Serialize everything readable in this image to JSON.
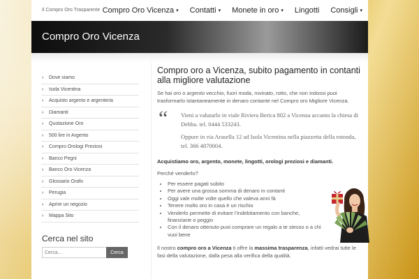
{
  "site": {
    "tagline": "Il Compro Oro Trasparente",
    "header_title": "Compro Oro Vicenza"
  },
  "nav": {
    "items": [
      {
        "label": "Compro Oro Vicenza",
        "caret": "▾"
      },
      {
        "label": "Contatti",
        "caret": "▾"
      },
      {
        "label": "Monete in oro",
        "caret": "▾"
      },
      {
        "label": "Lingotti",
        "caret": ""
      },
      {
        "label": "Consigli",
        "caret": "▾"
      }
    ]
  },
  "sidebar": {
    "items": [
      "Dove siamo",
      "Isola Vicentina",
      "Acquisto argento e argenteria",
      "Diamanti",
      "Quotazione Oro",
      "500 lire in Argento",
      "Compro Orologi Preziosi",
      "Banco Pegni",
      "Banco Oro Vicenza",
      "Glossario Orafo",
      "Perugia",
      "Aprire un negozio",
      "Mappa Sito"
    ],
    "search_title": "Cerca nel sito",
    "search_placeholder": "Cerca...",
    "search_button": "Cerca"
  },
  "content": {
    "title": "Compro oro a Vicenza, subito pagamento in contanti alla migliore valutazione",
    "intro_1": "Se hai ",
    "intro_em_1": "oro",
    "intro_2": " o ",
    "intro_em_2": "argento",
    "intro_3": " vecchio, fuori moda, rovinato, rotto, che non indossi puoi trasformarlo istantaneamente in denaro contante nel Compro oro Migliore Vicenza.",
    "quote_mark": "“",
    "quote_1": "Vieni a valutarlo in viale Riviera Berica 802 a Vicenza accanto la chiesa di Debba.  tel.  0444 533243.",
    "quote_2": "Oppure in via Arasella 12 ad Isola Vicentina nella piazzetta della rotonda, tel. 366 4870004.",
    "bold_line": "Acquistiamo oro, argento, monete, lingotti, orologi preziosi e diamanti.",
    "why": "Perché venderlo?",
    "bullets": [
      "Per essere pagati subito",
      "Per avere una grossa somma di denaro in contanti",
      "Oggi vale molte volte quello che valeva anni fà",
      "Tenere molto oro in casa è un rischio",
      "Venderlo permette di evitare l’indebitamento con banche, finanziarie o peggio",
      "Con il denaro ottenuto puoi comprare un regalo a te stesso o a chi vuoi bene"
    ],
    "closing_1": "Il nostro ",
    "closing_b1": "compro oro a Vicenza",
    "closing_2": " ti offre la ",
    "closing_b2": "massima trasparenza",
    "closing_3": ", infatti vedrai tutte le fasi della valutazione, dalla pesa alla verifica della qualità."
  }
}
